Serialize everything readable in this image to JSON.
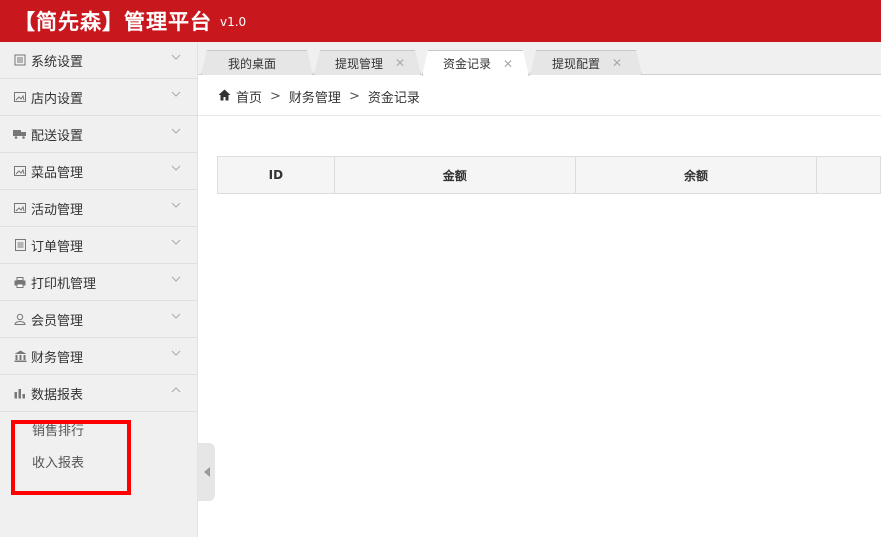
{
  "header": {
    "title": "【简先森】管理平台",
    "version": "v1.0",
    "background": "#c9171e"
  },
  "sidebar": {
    "items": [
      {
        "label": "系统设置",
        "icon": "list-icon"
      },
      {
        "label": "店内设置",
        "icon": "image-icon"
      },
      {
        "label": "配送设置",
        "icon": "truck-icon"
      },
      {
        "label": "菜品管理",
        "icon": "image-icon"
      },
      {
        "label": "活动管理",
        "icon": "image-icon"
      },
      {
        "label": "订单管理",
        "icon": "document-icon"
      },
      {
        "label": "打印机管理",
        "icon": "printer-icon"
      },
      {
        "label": "会员管理",
        "icon": "user-icon"
      },
      {
        "label": "财务管理",
        "icon": "bank-icon"
      },
      {
        "label": "数据报表",
        "icon": "bar-chart-icon",
        "expanded": true
      }
    ],
    "subitems": [
      {
        "label": "销售排行"
      },
      {
        "label": "收入报表"
      }
    ]
  },
  "tabs": [
    {
      "label": "我的桌面",
      "closable": false
    },
    {
      "label": "提现管理",
      "closable": true
    },
    {
      "label": "资金记录",
      "closable": true,
      "active": true
    },
    {
      "label": "提现配置",
      "closable": true
    }
  ],
  "breadcrumb": {
    "home": "首页",
    "separator": ">",
    "level1": "财务管理",
    "level2": "资金记录"
  },
  "table": {
    "columns": [
      "ID",
      "金额",
      "余额",
      ""
    ]
  },
  "colors": {
    "highlight": "#ff0000"
  }
}
